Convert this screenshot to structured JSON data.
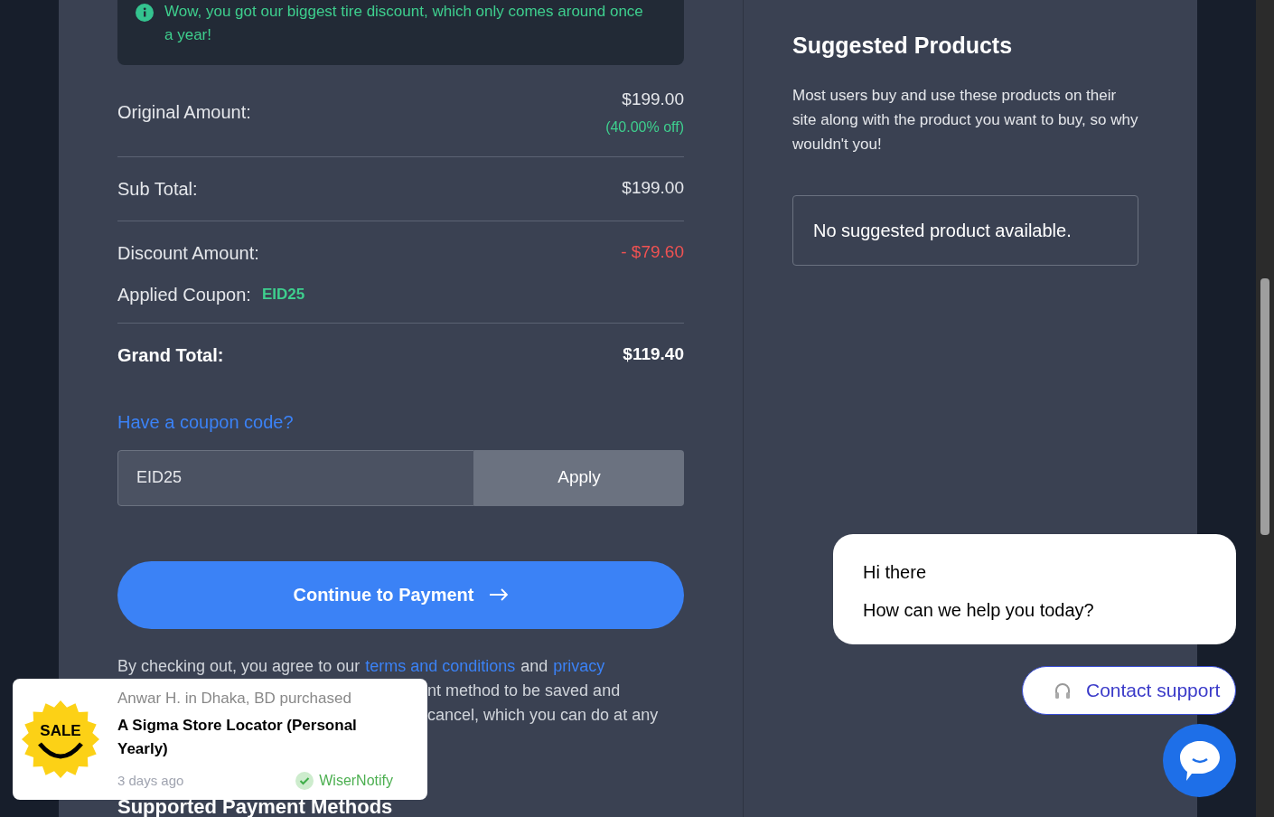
{
  "notice": {
    "text": "Wow, you got our biggest tire discount, which only comes around once a year!"
  },
  "summary": {
    "original_label": "Original Amount:",
    "original_value": "$199.00",
    "off": "(40.00% off)",
    "subtotal_label": "Sub Total:",
    "subtotal_value": "$199.00",
    "discount_label": "Discount Amount:",
    "discount_value": "- $79.60",
    "coupon_label": "Applied Coupon:",
    "coupon_value": "EID25",
    "grand_label": "Grand Total:",
    "grand_value": "$119.40"
  },
  "coupon": {
    "link": "Have a coupon code?",
    "value": "EID25",
    "apply": "Apply"
  },
  "continue_button": "Continue to Payment",
  "terms": {
    "line_1_start": "By checking out, you agree to our",
    "terms_link": "terms and conditions",
    "and": "and",
    "privacy_link": "privacy",
    "line_2": "nt method to be saved and",
    "line_3": "cancel, which you can do at any"
  },
  "payment_heading": "Supported Payment Methods",
  "suggested": {
    "title": "Suggested Products",
    "description": "Most users buy and use these products on their site along with the product you want to buy, so why wouldn't you!",
    "empty": "No suggested product available."
  },
  "chat": {
    "greeting": "Hi there",
    "question": "How can we help you today?",
    "contact": "Contact support"
  },
  "purchase_popup": {
    "badge": "SALE",
    "who": "Anwar H. in Dhaka, BD purchased",
    "product": "A Sigma Store Locator (Personal Yearly)",
    "time": "3 days ago",
    "brand": "WiserNotify"
  }
}
